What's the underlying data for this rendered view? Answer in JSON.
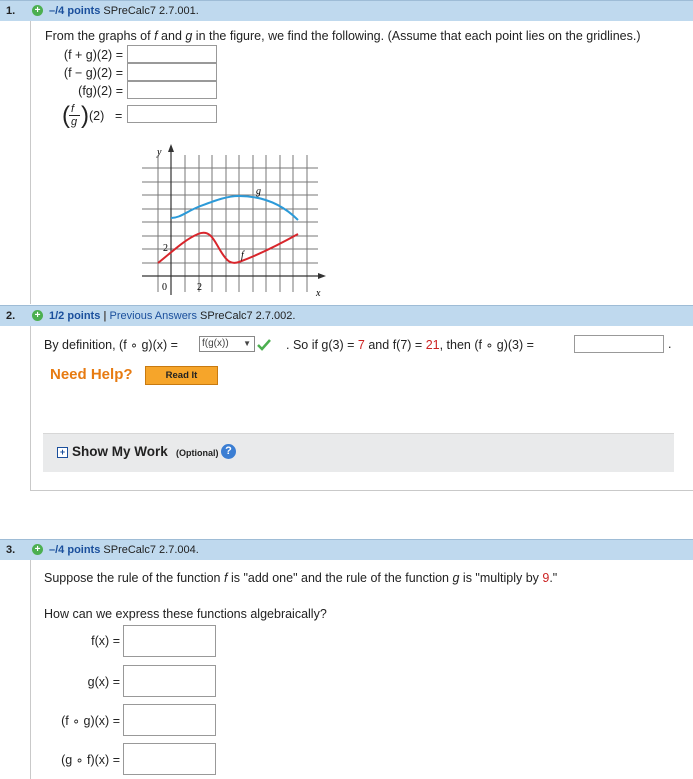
{
  "q1": {
    "number": "1.",
    "points": "–/4 points",
    "ref": "SPreCalc7 2.7.001.",
    "prompt_start": "From the graphs of ",
    "prompt_f": "f",
    "prompt_mid": " and ",
    "prompt_g": "g",
    "prompt_end": " in the figure, we find the following. (Assume that each point lies on the gridlines.)",
    "rows": [
      {
        "expr": "(f + g)(2)",
        "eq": "="
      },
      {
        "expr": "(f − g)(2)",
        "eq": "="
      },
      {
        "expr": "(fg)(2)",
        "eq": "="
      },
      {
        "expr": "(2)",
        "eq": "="
      }
    ],
    "frac_num": "f",
    "frac_den": "g",
    "graph": {
      "y_label": "y",
      "x_label": "x",
      "g_label": "g",
      "f_label": "f",
      "origin_label": "0",
      "x_tick_label": "2",
      "y_tick_label": "2",
      "g_color": "#2c9ad8",
      "f_color": "#d8262c"
    }
  },
  "q2": {
    "number": "2.",
    "points": "1/2 points",
    "separator": "|",
    "previous_answers": "Previous Answers",
    "ref": "SPreCalc7 2.7.002.",
    "definition_text": "By definition, (f ∘ g)(x) =",
    "select_value": "f(g(x))",
    "after_select": ". So if g(3) =",
    "g3_value": "7",
    "and_text": "and f(7) =",
    "f7_value": "21",
    "then_text": ", then (f ∘ g)(3) =",
    "period": ".",
    "need_help": "Need Help?",
    "read_it": "Read It",
    "show_my_work": "Show My Work",
    "optional": "(Optional)"
  },
  "q3": {
    "number": "3.",
    "points": "–/4 points",
    "ref": "SPreCalc7 2.7.004.",
    "rule_text_1": "Suppose the rule of the function ",
    "rule_f": "f",
    "rule_text_2": " is \"add one\" and the rule of the function ",
    "rule_g": "g",
    "rule_text_3": " is \"multiply by ",
    "multiplier": "9",
    "rule_text_4": ".\"",
    "question": "How can we express these functions algebraically?",
    "rows": [
      {
        "expr": "f(x)",
        "eq": "="
      },
      {
        "expr": "g(x)",
        "eq": "="
      },
      {
        "expr": "(f ∘ g)(x)",
        "eq": "="
      },
      {
        "expr": "(g ∘ f)(x)",
        "eq": "="
      }
    ]
  },
  "colors": {
    "header_bg": "#bfd9ee",
    "link": "#1a4f9c",
    "need_help": "#e77b12",
    "read_it_bg": "#f6a52a",
    "correct_check": "#4caf50",
    "highlight_number": "#cc2222"
  },
  "icons": {
    "expand": "plus-circle-icon",
    "correct": "checkmark-icon",
    "help": "question-circle-icon",
    "show_work_toggle": "plus-square-icon",
    "dropdown": "dropdown-arrow-icon"
  }
}
